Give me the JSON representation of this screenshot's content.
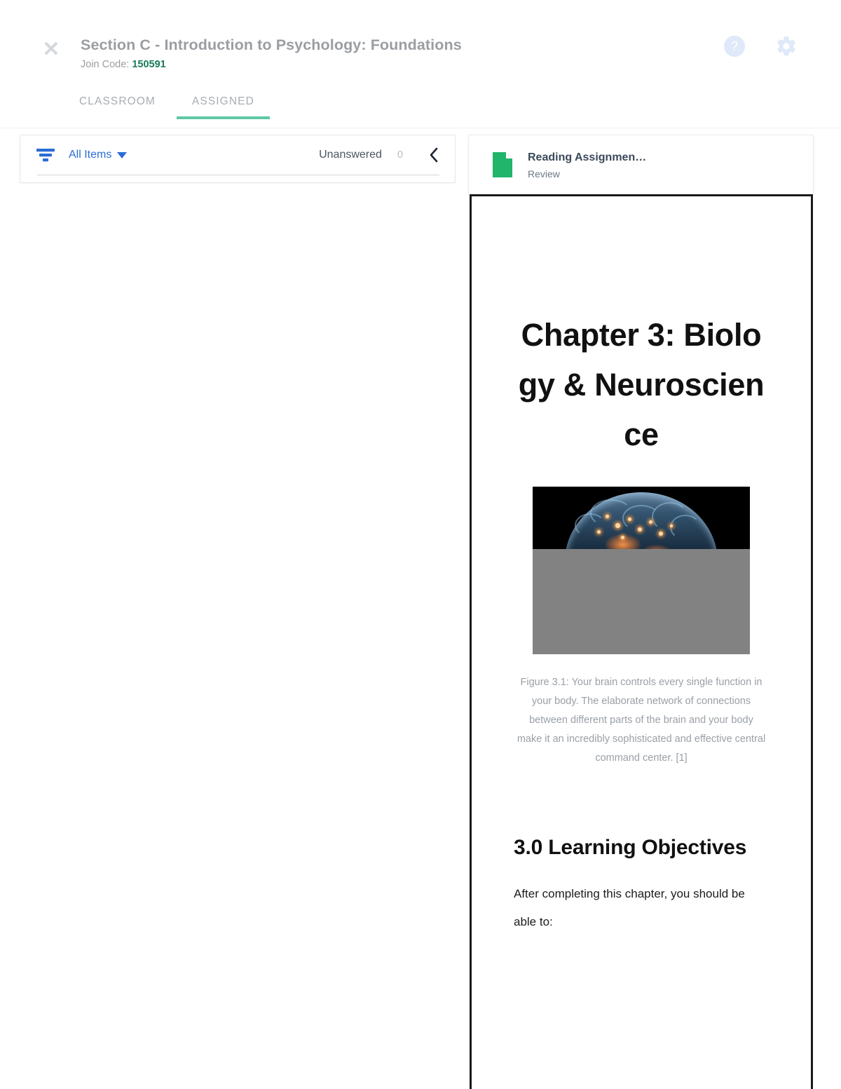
{
  "header": {
    "close_icon": "close-icon",
    "course_title": "Section C - Introduction to Psychology: Foundations",
    "join_code_label": "Join Code:",
    "join_code_value": "150591",
    "help_icon_glyph": "?",
    "help_icon_name": "help-icon",
    "gear_icon_name": "gear-icon",
    "accent_green": "#5ec9a4",
    "join_code_color": "#1c7a5a",
    "link_blue": "#2b6cd4"
  },
  "tabs": [
    {
      "label": "CLASSROOM",
      "active": false
    },
    {
      "label": "ASSIGNED",
      "active": true
    }
  ],
  "filter_bar": {
    "filter_icon": "filter-icon",
    "filter_label": "All Items",
    "caret_icon": "chevron-down-icon",
    "unanswered_label": "Unanswered",
    "unanswered_count": "0",
    "collapse_icon": "chevron-left-icon"
  },
  "assignment": {
    "doc_icon": "document-icon",
    "doc_icon_color": "#21b46b",
    "title": "Reading Assignmen…",
    "subtitle": "Review"
  },
  "document": {
    "heading": "Chapter 3: Biology & Neuroscience",
    "figure_caption": "Figure 3.1: Your brain controls every single function in your body. The elaborate network of connections between different parts of the brain and your body make it an incredibly sophisticated and effective central command center. [1]",
    "section_heading": "3.0 Learning Objectives",
    "section_body": "After completing this chapter, you should be able to:"
  }
}
